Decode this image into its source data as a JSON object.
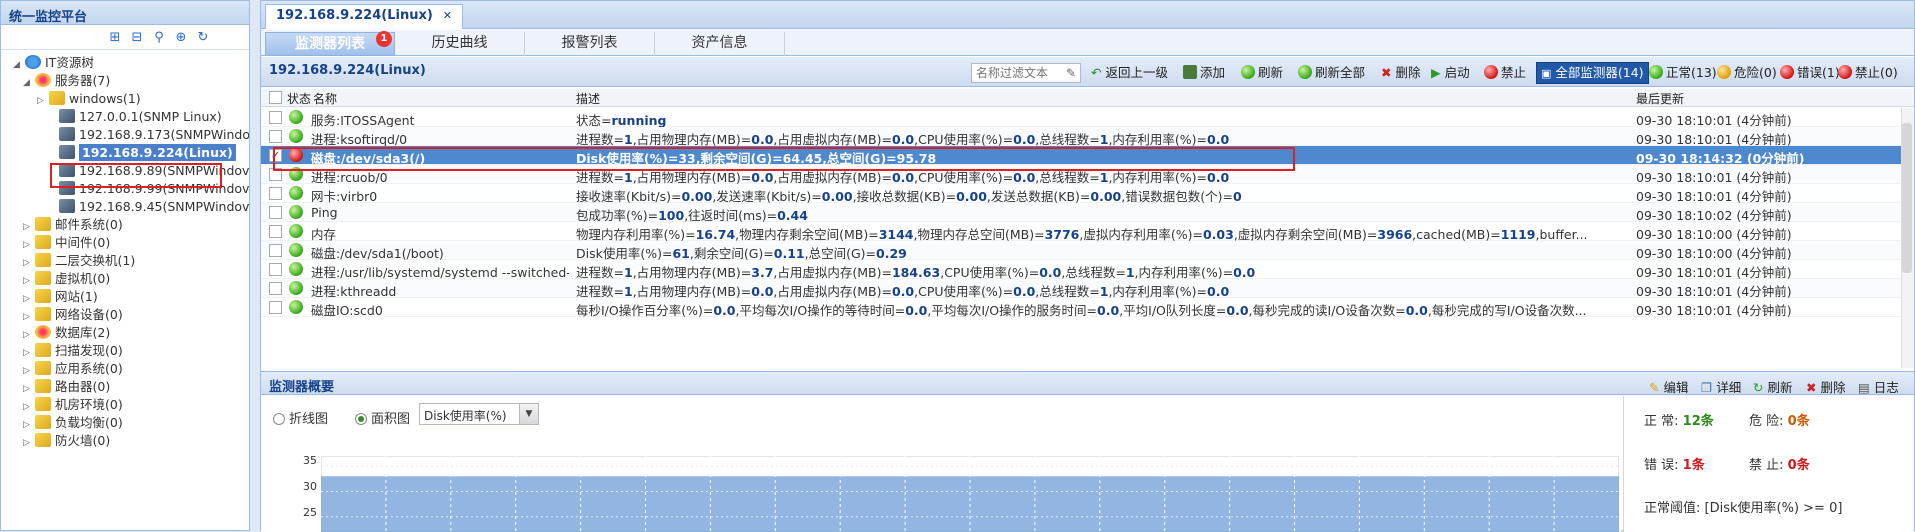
{
  "left_panel": {
    "title": "统一监控平台",
    "tree": [
      {
        "label": "IT资源树",
        "level": 0,
        "icon": "root"
      },
      {
        "label": "服务器(7)",
        "level": 1,
        "icon": "grp"
      },
      {
        "label": "windows(1)",
        "level": 2,
        "icon": "fold"
      },
      {
        "label": "127.0.0.1(SNMP Linux)",
        "level": 3,
        "icon": "srv"
      },
      {
        "label": "192.168.9.173(SNMPWindo",
        "level": 3,
        "icon": "srv"
      },
      {
        "label": "192.168.9.224(Linux)",
        "level": 3,
        "icon": "srv",
        "selected": true
      },
      {
        "label": "192.168.9.89(SNMPWindov",
        "level": 3,
        "icon": "srv"
      },
      {
        "label": "192.168.9.99(SNMPWindov",
        "level": 3,
        "icon": "srv"
      },
      {
        "label": "192.168.9.45(SNMPWindov",
        "level": 3,
        "icon": "srv"
      },
      {
        "label": "邮件系统(0)",
        "level": 1,
        "icon": "fold"
      },
      {
        "label": "中间件(0)",
        "level": 1,
        "icon": "fold"
      },
      {
        "label": "二层交换机(1)",
        "level": 1,
        "icon": "fold"
      },
      {
        "label": "虚拟机(0)",
        "level": 1,
        "icon": "fold"
      },
      {
        "label": "网站(1)",
        "level": 1,
        "icon": "fold"
      },
      {
        "label": "网络设备(0)",
        "level": 1,
        "icon": "fold"
      },
      {
        "label": "数据库(2)",
        "level": 1,
        "icon": "grp"
      },
      {
        "label": "扫描发现(0)",
        "level": 1,
        "icon": "fold"
      },
      {
        "label": "应用系统(0)",
        "level": 1,
        "icon": "fold"
      },
      {
        "label": "路由器(0)",
        "level": 1,
        "icon": "fold"
      },
      {
        "label": "机房环境(0)",
        "level": 1,
        "icon": "fold"
      },
      {
        "label": "负载均衡(0)",
        "level": 1,
        "icon": "fold"
      },
      {
        "label": "防火墙(0)",
        "level": 1,
        "icon": "fold"
      }
    ]
  },
  "main": {
    "tab_title": "192.168.9.224(Linux)",
    "subtabs": [
      "监测器列表",
      "历史曲线",
      "报警列表",
      "资产信息"
    ],
    "subtab_badge": "1",
    "grid_title": "192.168.9.224(Linux)",
    "filter_placeholder": "名称过滤文本",
    "toolbar": {
      "back": "返回上一级",
      "add": "添加",
      "refresh": "刷新",
      "refresh_all": "刷新全部",
      "delete": "删除",
      "start": "启动",
      "disable": "禁止",
      "all_monitors": "全部监测器(14)",
      "normal": "正常(13)",
      "danger": "危险(0)",
      "error": "错误(1)",
      "forbidden": "禁止(0)"
    },
    "columns": {
      "status": "状态",
      "name": "名称",
      "desc": "描述",
      "time": "最后更新"
    },
    "rows": [
      {
        "status": "green",
        "name": "服务:ITOSSAgent",
        "desc": "状态=running",
        "time": "09-30 18:10:01 (4分钟前)"
      },
      {
        "status": "green",
        "name": "进程:ksoftirqd/0",
        "desc": "进程数=1,占用物理内存(MB)=0.0,占用虚拟内存(MB)=0.0,CPU使用率(%)=0.0,总线程数=1,内存利用率(%)=0.0",
        "time": "09-30 18:10:01 (4分钟前)"
      },
      {
        "status": "red",
        "name": "磁盘:/dev/sda3(/)",
        "desc": "Disk使用率(%)=33,剩余空间(G)=64.45,总空间(G)=95.78",
        "time": "09-30 18:14:32 (0分钟前)",
        "selected": true
      },
      {
        "status": "green",
        "name": "进程:rcuob/0",
        "desc": "进程数=1,占用物理内存(MB)=0.0,占用虚拟内存(MB)=0.0,CPU使用率(%)=0.0,总线程数=1,内存利用率(%)=0.0",
        "time": "09-30 18:10:01 (4分钟前)"
      },
      {
        "status": "green",
        "name": "网卡:virbr0",
        "desc": "接收速率(Kbit/s)=0.00,发送速率(Kbit/s)=0.00,接收总数据(KB)=0.00,发送总数据(KB)=0.00,错误数据包数(个)=0",
        "time": "09-30 18:10:01 (4分钟前)"
      },
      {
        "status": "green",
        "name": "Ping",
        "desc": "包成功率(%)=100,往返时间(ms)=0.44",
        "time": "09-30 18:10:02 (4分钟前)"
      },
      {
        "status": "green",
        "name": "内存",
        "desc": "物理内存利用率(%)=16.74,物理内存剩余空间(MB)=3144,物理内存总空间(MB)=3776,虚拟内存利用率(%)=0.03,虚拟内存剩余空间(MB)=3966,cached(MB)=1119,buffer...",
        "time": "09-30 18:10:00 (4分钟前)"
      },
      {
        "status": "green",
        "name": "磁盘:/dev/sda1(/boot)",
        "desc": "Disk使用率(%)=61,剩余空间(G)=0.11,总空间(G)=0.29",
        "time": "09-30 18:10:00 (4分钟前)"
      },
      {
        "status": "green",
        "name": "进程:/usr/lib/systemd/systemd --switched-root --sy...",
        "desc": "进程数=1,占用物理内存(MB)=3.7,占用虚拟内存(MB)=184.63,CPU使用率(%)=0.0,总线程数=1,内存利用率(%)=0.0",
        "time": "09-30 18:10:01 (4分钟前)"
      },
      {
        "status": "green",
        "name": "进程:kthreadd",
        "desc": "进程数=1,占用物理内存(MB)=0.0,占用虚拟内存(MB)=0.0,CPU使用率(%)=0.0,总线程数=1,内存利用率(%)=0.0",
        "time": "09-30 18:10:01 (4分钟前)"
      },
      {
        "status": "green",
        "name": "磁盘IO:scd0",
        "desc": "每秒I/O操作百分率(%)=0.0,平均每次I/O操作的等待时间=0.0,平均每次I/O操作的服务时间=0.0,平均I/O队列长度=0.0,每秒完成的读I/O设备次数=0.0,每秒完成的写I/O设备次数...",
        "time": "09-30 18:10:01 (4分钟前)"
      }
    ]
  },
  "overview": {
    "title": "监测器概要",
    "edit": "编辑",
    "detail": "详细",
    "refresh": "刷新",
    "delete": "删除",
    "log": "日志",
    "radio_line": "折线图",
    "radio_area": "面积图",
    "combo_value": "Disk使用率(%)",
    "y_ticks": [
      "35",
      "30",
      "25"
    ],
    "stats": {
      "normal_label": "正 常:",
      "normal_value": "12条",
      "danger_label": "危 险:",
      "danger_value": "0条",
      "error_label": "错 误:",
      "error_value": "1条",
      "forbid_label": "禁 止:",
      "forbid_value": "0条",
      "threshold_label": "正常阈值:",
      "threshold_value": "[Disk使用率(%) >= 0]"
    }
  },
  "chart_data": {
    "type": "area",
    "ylim": [
      22,
      37
    ],
    "y_ticks": [
      25,
      30,
      35
    ],
    "series": [
      {
        "values": [
          33,
          33,
          33,
          33,
          33,
          33,
          33,
          33,
          33,
          33,
          33,
          33,
          33,
          33,
          33,
          33,
          33,
          33,
          33,
          33
        ]
      }
    ],
    "grid": true
  }
}
